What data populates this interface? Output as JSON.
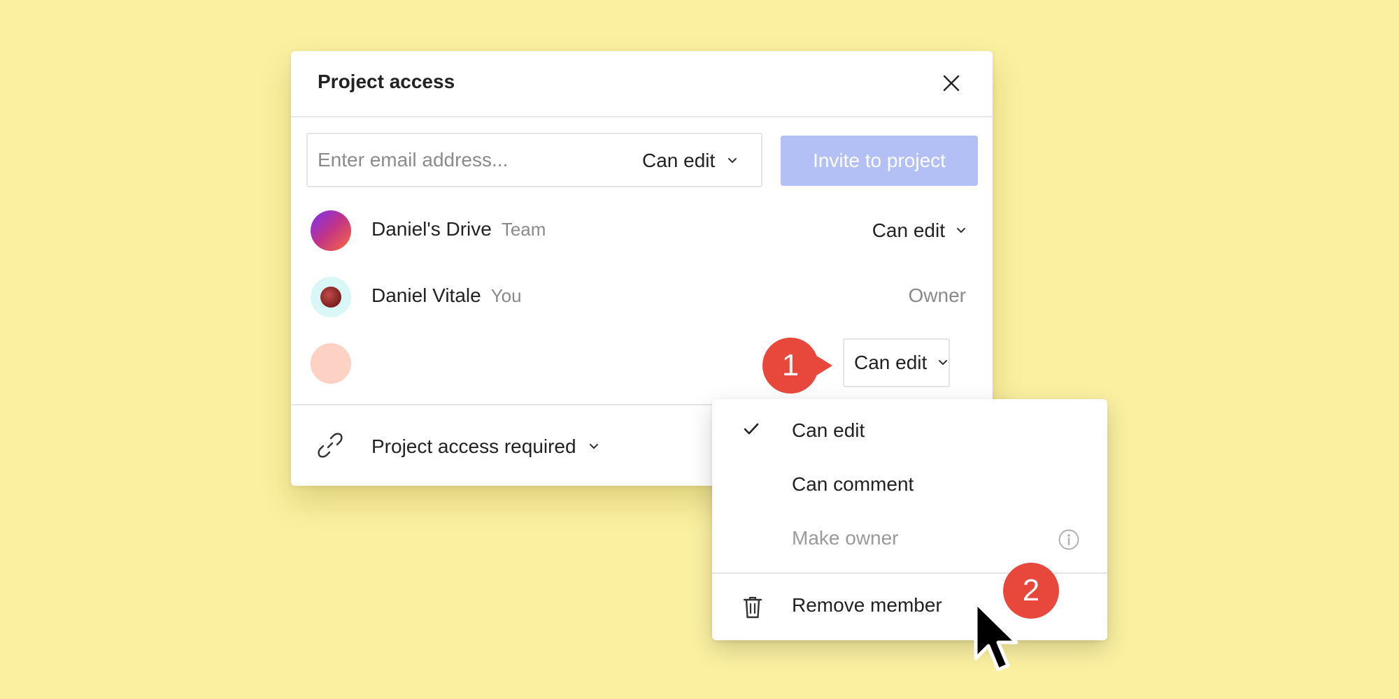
{
  "dialog": {
    "title": "Project access",
    "invite": {
      "email_placeholder": "Enter email address...",
      "role": "Can edit",
      "button_label": "Invite to project"
    },
    "members": [
      {
        "name": "Daniel's Drive",
        "tag": "Team",
        "role": "Can edit"
      },
      {
        "name": "Daniel Vitale",
        "tag": "You",
        "role": "Owner"
      },
      {
        "name": "",
        "tag": "",
        "role": "Can edit"
      }
    ],
    "link_access": "Project access required"
  },
  "role_menu": {
    "items": [
      {
        "label": "Can edit",
        "checked": true
      },
      {
        "label": "Can comment",
        "checked": false
      },
      {
        "label": "Make owner",
        "disabled": true
      },
      {
        "label": "Remove member"
      }
    ]
  },
  "annotations": {
    "step1": "1",
    "step2": "2"
  },
  "colors": {
    "background": "#fbf0a0",
    "invite_button": "#b3c0f6",
    "badge": "#e8473c"
  }
}
